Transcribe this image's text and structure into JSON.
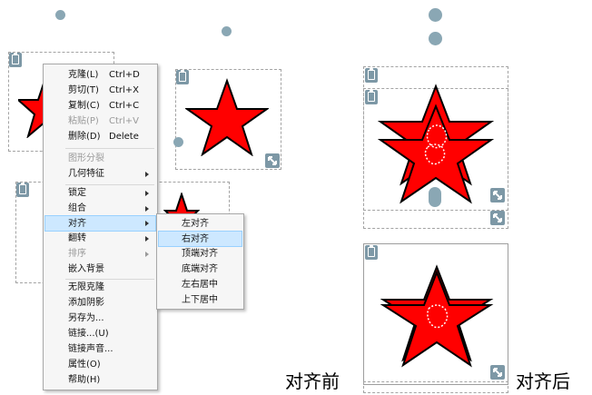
{
  "colors": {
    "star_fill": "#ff0000",
    "star_outline": "#000000",
    "accent_icon": "#7d98a6",
    "menu_highlight": "#cde8ff"
  },
  "context_menu": {
    "items": [
      {
        "label": "克隆(L)",
        "shortcut": "Ctrl+D",
        "disabled": false
      },
      {
        "label": "剪切(T)",
        "shortcut": "Ctrl+X",
        "disabled": false
      },
      {
        "label": "复制(C)",
        "shortcut": "Ctrl+C",
        "disabled": false
      },
      {
        "label": "粘贴(P)",
        "shortcut": "Ctrl+V",
        "disabled": true
      },
      {
        "label": "删除(D)",
        "shortcut": "Delete",
        "disabled": false
      },
      {
        "label": "图形分裂",
        "disabled": true
      },
      {
        "label": "几何特征",
        "submenu": true
      },
      {
        "label": "锁定",
        "submenu": true
      },
      {
        "label": "组合",
        "submenu": true
      },
      {
        "label": "对齐",
        "submenu": true,
        "highlighted": true
      },
      {
        "label": "翻转",
        "submenu": true
      },
      {
        "label": "排序",
        "submenu": true,
        "disabled": true
      },
      {
        "label": "嵌入背景"
      },
      {
        "label": "无限克隆"
      },
      {
        "label": "添加阴影"
      },
      {
        "label": "另存为..."
      },
      {
        "label": "链接...(U)"
      },
      {
        "label": "链接声音..."
      },
      {
        "label": "属性(O)"
      },
      {
        "label": "帮助(H)"
      }
    ]
  },
  "align_submenu": {
    "items": [
      {
        "label": "左对齐"
      },
      {
        "label": "右对齐",
        "highlighted": true
      },
      {
        "label": "顶端对齐"
      },
      {
        "label": "底端对齐"
      },
      {
        "label": "左右居中"
      },
      {
        "label": "上下居中"
      }
    ]
  },
  "captions": {
    "before": "对齐前",
    "after": "对齐后"
  }
}
